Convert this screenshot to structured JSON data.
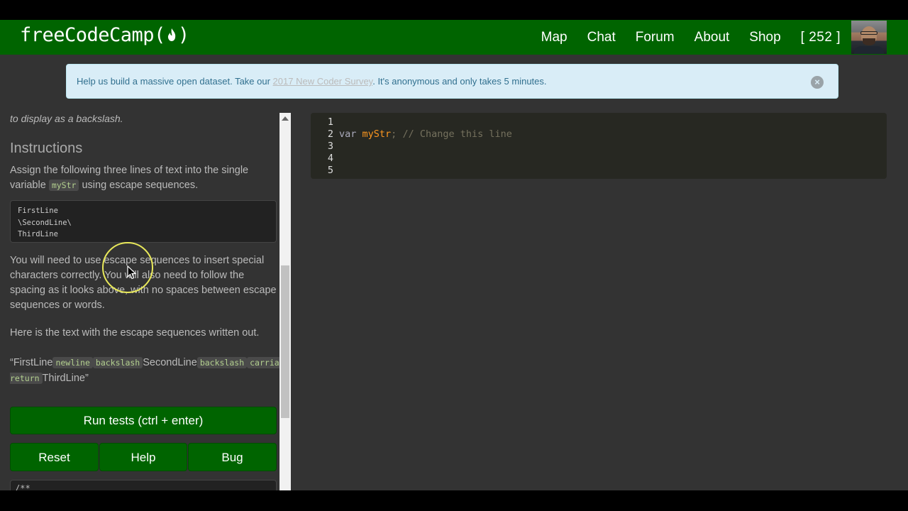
{
  "brand": {
    "logo_text": "freeCodeCamp(",
    "logo_close": ")"
  },
  "nav": {
    "links": [
      "Map",
      "Chat",
      "Forum",
      "About",
      "Shop"
    ],
    "points": "[ 252 ]"
  },
  "alert": {
    "text_before": "Help us build a massive open dataset. Take our ",
    "link_text": "2017 New Coder Survey",
    "text_after": ". It's anonymous and only takes 5 minutes.",
    "close_symbol": "×"
  },
  "lesson": {
    "partial_line": "to display as a backslash.",
    "instructions_heading": "Instructions",
    "assign_text_a": "Assign the following three lines of text into the single variable ",
    "assign_var": "myStr",
    "assign_text_b": " using escape sequences.",
    "code_lines": [
      "FirstLine",
      "\\SecondLine\\",
      "ThirdLine"
    ],
    "para2": "You will need to use escape sequences to insert special characters correctly. You will also need to follow the spacing as it looks above, with no spaces between escape sequences or words.",
    "para3": "Here is the text with the escape sequences written out.",
    "para4_parts": [
      "“FirstLine",
      "newline",
      "backslash",
      "SecondLine",
      "backslash",
      "carriage-return",
      "ThirdLine”"
    ]
  },
  "buttons": {
    "run": "Run tests (ctrl + enter)",
    "reset": "Reset",
    "help": "Help",
    "bug": "Bug"
  },
  "bottom_code": "/**",
  "editor": {
    "line_numbers": [
      "1",
      "2",
      "3",
      "4",
      "5"
    ],
    "line2": {
      "keyword": "var",
      "identifier": "myStr",
      "punct": ";",
      "comment": "// Change this line"
    }
  },
  "colors": {
    "brand_green": "#006400",
    "background": "#333333",
    "alert_bg": "#d9edf7"
  }
}
